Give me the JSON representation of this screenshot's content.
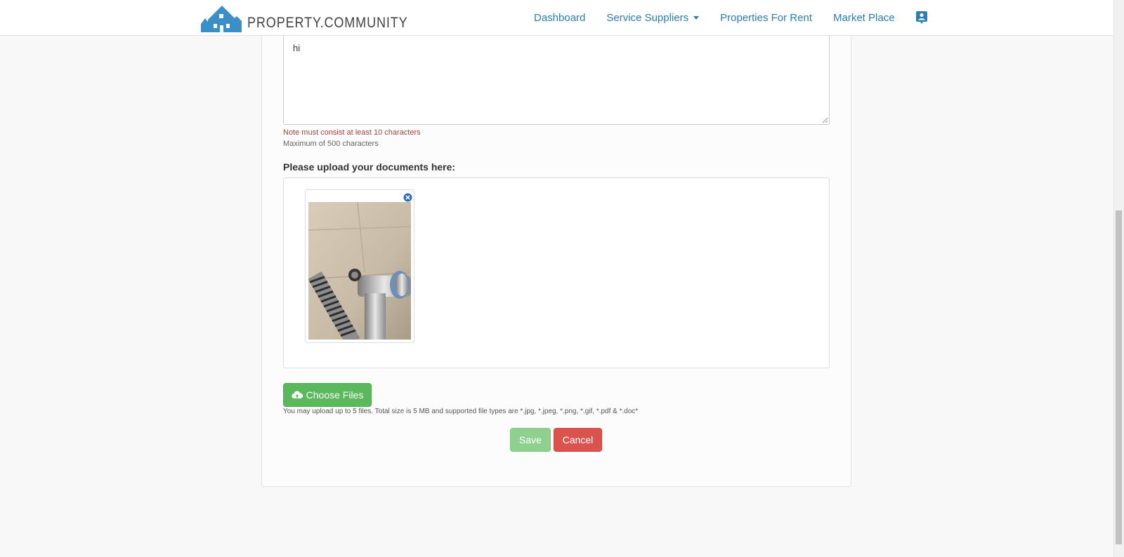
{
  "brand": {
    "name": "PROPERTY.COMMUNITY",
    "logo_icon": "houses-logo",
    "color": "#3a8fc8"
  },
  "nav": {
    "dashboard": "Dashboard",
    "service_suppliers": "Service Suppliers",
    "properties_for_rent": "Properties For Rent",
    "market_place": "Market Place",
    "profile_icon": "contact-card-icon",
    "link_color": "#2a7fb0"
  },
  "form": {
    "note_value": "hi",
    "note_error": "Note must consist at least 10 characters",
    "note_help": "Maximum of 500 characters",
    "upload_label": "Please upload your documents here:",
    "choose_files_label": "Choose Files",
    "upload_help": "You may upload up to 5 files. Total size is 5 MB and supported file types are *.jpg, *.jpeg, *.png, *.gif, *.pdf & *.doc*",
    "save_label": "Save",
    "cancel_label": "Cancel",
    "uploaded_files": [
      {
        "type": "image",
        "remove_icon": "remove-circle-icon"
      }
    ]
  },
  "colors": {
    "success": "#5cb85c",
    "success_disabled": "#8fd08f",
    "danger": "#d9534f",
    "error_text": "#a94442"
  }
}
